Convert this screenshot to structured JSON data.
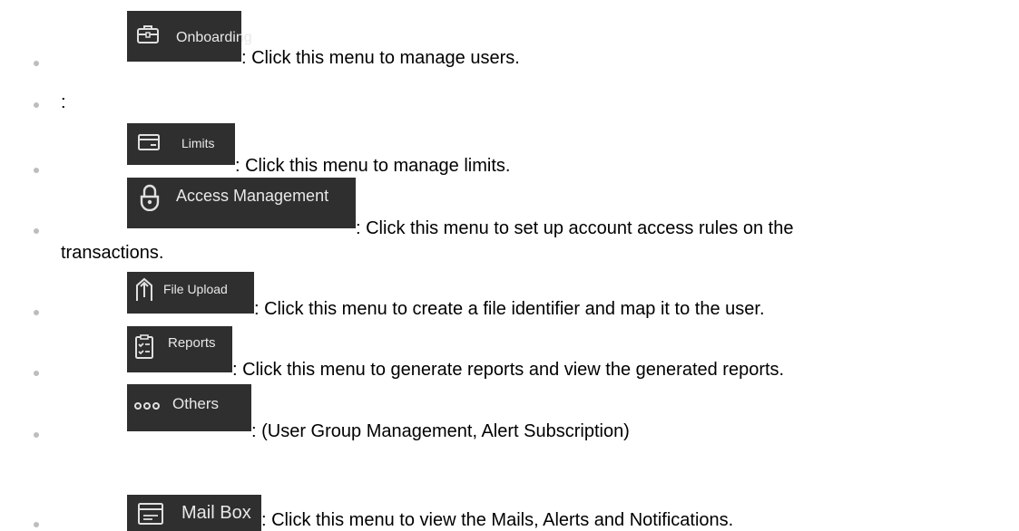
{
  "items": [
    {
      "menu_label": "Onboarding",
      "icon": "briefcase-icon",
      "description": ": Click this menu to manage users."
    },
    {
      "menu_label": "",
      "icon": "",
      "description": ":"
    },
    {
      "menu_label": "Limits",
      "icon": "card-icon",
      "description": ": Click this menu to manage limits."
    },
    {
      "menu_label": "Access Management",
      "icon": "lock-icon",
      "description": ":   Click   this   menu   to   set   up   account   access   rules   on   the",
      "description_cont": "transactions."
    },
    {
      "menu_label": "File Upload",
      "icon": "upload-icon",
      "description": ": Click this menu to create a file identifier and map it to the user."
    },
    {
      "menu_label": "Reports",
      "icon": "checklist-icon",
      "description": ": Click this menu to generate reports and view the generated reports."
    },
    {
      "menu_label": "Others",
      "icon": "more-icon",
      "description": ": (User Group Management, Alert Subscription)"
    },
    {
      "menu_label": "Mail Box",
      "icon": "mailbox-icon",
      "description": ": Click this menu to view the Mails, Alerts and Notifications."
    }
  ]
}
